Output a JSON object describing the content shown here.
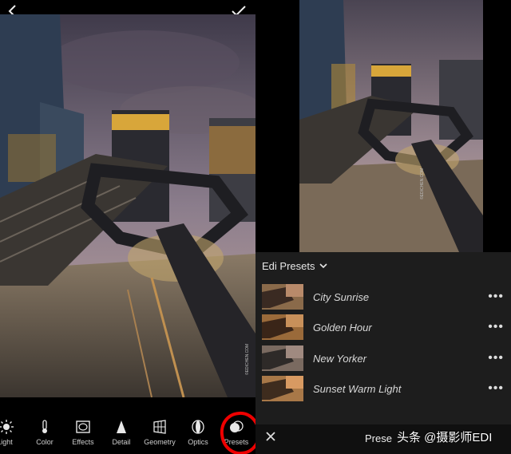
{
  "editor": {
    "back_icon": "chevron-left-icon",
    "confirm_icon": "checkmark-icon",
    "photo_credit": "©EDICHEN.COM"
  },
  "toolbar": {
    "items": [
      {
        "label": "Light",
        "icon": "sun-icon"
      },
      {
        "label": "Color",
        "icon": "thermometer-icon"
      },
      {
        "label": "Effects",
        "icon": "vignette-icon"
      },
      {
        "label": "Detail",
        "icon": "triangle-icon"
      },
      {
        "label": "Geometry",
        "icon": "grid-icon"
      },
      {
        "label": "Optics",
        "icon": "lens-icon"
      },
      {
        "label": "Presets",
        "icon": "overlapping-circles-icon"
      }
    ],
    "highlight_color": "#e00000"
  },
  "presets_panel": {
    "group_name": "Edi Presets",
    "items": [
      {
        "name": "City Sunrise"
      },
      {
        "name": "Golden Hour"
      },
      {
        "name": "New Yorker"
      },
      {
        "name": "Sunset Warm Light"
      }
    ],
    "more_icon": "more-dots-icon",
    "close_icon": "close-icon",
    "bottom_label": "Prese",
    "watermark": "头条 @摄影师EDI",
    "photo_credit": "©EDICHEN.COM"
  }
}
